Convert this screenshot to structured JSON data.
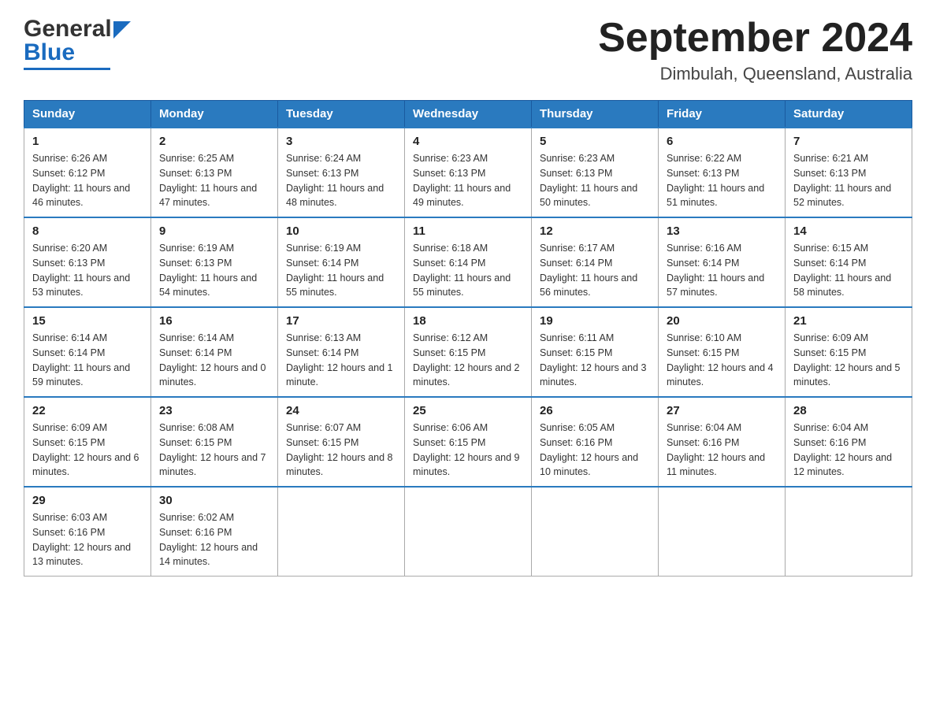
{
  "header": {
    "logo": {
      "general": "General",
      "blue": "Blue"
    },
    "title": "September 2024",
    "location": "Dimbulah, Queensland, Australia"
  },
  "weekdays": [
    "Sunday",
    "Monday",
    "Tuesday",
    "Wednesday",
    "Thursday",
    "Friday",
    "Saturday"
  ],
  "weeks": [
    [
      {
        "day": "1",
        "sunrise": "Sunrise: 6:26 AM",
        "sunset": "Sunset: 6:12 PM",
        "daylight": "Daylight: 11 hours and 46 minutes."
      },
      {
        "day": "2",
        "sunrise": "Sunrise: 6:25 AM",
        "sunset": "Sunset: 6:13 PM",
        "daylight": "Daylight: 11 hours and 47 minutes."
      },
      {
        "day": "3",
        "sunrise": "Sunrise: 6:24 AM",
        "sunset": "Sunset: 6:13 PM",
        "daylight": "Daylight: 11 hours and 48 minutes."
      },
      {
        "day": "4",
        "sunrise": "Sunrise: 6:23 AM",
        "sunset": "Sunset: 6:13 PM",
        "daylight": "Daylight: 11 hours and 49 minutes."
      },
      {
        "day": "5",
        "sunrise": "Sunrise: 6:23 AM",
        "sunset": "Sunset: 6:13 PM",
        "daylight": "Daylight: 11 hours and 50 minutes."
      },
      {
        "day": "6",
        "sunrise": "Sunrise: 6:22 AM",
        "sunset": "Sunset: 6:13 PM",
        "daylight": "Daylight: 11 hours and 51 minutes."
      },
      {
        "day": "7",
        "sunrise": "Sunrise: 6:21 AM",
        "sunset": "Sunset: 6:13 PM",
        "daylight": "Daylight: 11 hours and 52 minutes."
      }
    ],
    [
      {
        "day": "8",
        "sunrise": "Sunrise: 6:20 AM",
        "sunset": "Sunset: 6:13 PM",
        "daylight": "Daylight: 11 hours and 53 minutes."
      },
      {
        "day": "9",
        "sunrise": "Sunrise: 6:19 AM",
        "sunset": "Sunset: 6:13 PM",
        "daylight": "Daylight: 11 hours and 54 minutes."
      },
      {
        "day": "10",
        "sunrise": "Sunrise: 6:19 AM",
        "sunset": "Sunset: 6:14 PM",
        "daylight": "Daylight: 11 hours and 55 minutes."
      },
      {
        "day": "11",
        "sunrise": "Sunrise: 6:18 AM",
        "sunset": "Sunset: 6:14 PM",
        "daylight": "Daylight: 11 hours and 55 minutes."
      },
      {
        "day": "12",
        "sunrise": "Sunrise: 6:17 AM",
        "sunset": "Sunset: 6:14 PM",
        "daylight": "Daylight: 11 hours and 56 minutes."
      },
      {
        "day": "13",
        "sunrise": "Sunrise: 6:16 AM",
        "sunset": "Sunset: 6:14 PM",
        "daylight": "Daylight: 11 hours and 57 minutes."
      },
      {
        "day": "14",
        "sunrise": "Sunrise: 6:15 AM",
        "sunset": "Sunset: 6:14 PM",
        "daylight": "Daylight: 11 hours and 58 minutes."
      }
    ],
    [
      {
        "day": "15",
        "sunrise": "Sunrise: 6:14 AM",
        "sunset": "Sunset: 6:14 PM",
        "daylight": "Daylight: 11 hours and 59 minutes."
      },
      {
        "day": "16",
        "sunrise": "Sunrise: 6:14 AM",
        "sunset": "Sunset: 6:14 PM",
        "daylight": "Daylight: 12 hours and 0 minutes."
      },
      {
        "day": "17",
        "sunrise": "Sunrise: 6:13 AM",
        "sunset": "Sunset: 6:14 PM",
        "daylight": "Daylight: 12 hours and 1 minute."
      },
      {
        "day": "18",
        "sunrise": "Sunrise: 6:12 AM",
        "sunset": "Sunset: 6:15 PM",
        "daylight": "Daylight: 12 hours and 2 minutes."
      },
      {
        "day": "19",
        "sunrise": "Sunrise: 6:11 AM",
        "sunset": "Sunset: 6:15 PM",
        "daylight": "Daylight: 12 hours and 3 minutes."
      },
      {
        "day": "20",
        "sunrise": "Sunrise: 6:10 AM",
        "sunset": "Sunset: 6:15 PM",
        "daylight": "Daylight: 12 hours and 4 minutes."
      },
      {
        "day": "21",
        "sunrise": "Sunrise: 6:09 AM",
        "sunset": "Sunset: 6:15 PM",
        "daylight": "Daylight: 12 hours and 5 minutes."
      }
    ],
    [
      {
        "day": "22",
        "sunrise": "Sunrise: 6:09 AM",
        "sunset": "Sunset: 6:15 PM",
        "daylight": "Daylight: 12 hours and 6 minutes."
      },
      {
        "day": "23",
        "sunrise": "Sunrise: 6:08 AM",
        "sunset": "Sunset: 6:15 PM",
        "daylight": "Daylight: 12 hours and 7 minutes."
      },
      {
        "day": "24",
        "sunrise": "Sunrise: 6:07 AM",
        "sunset": "Sunset: 6:15 PM",
        "daylight": "Daylight: 12 hours and 8 minutes."
      },
      {
        "day": "25",
        "sunrise": "Sunrise: 6:06 AM",
        "sunset": "Sunset: 6:15 PM",
        "daylight": "Daylight: 12 hours and 9 minutes."
      },
      {
        "day": "26",
        "sunrise": "Sunrise: 6:05 AM",
        "sunset": "Sunset: 6:16 PM",
        "daylight": "Daylight: 12 hours and 10 minutes."
      },
      {
        "day": "27",
        "sunrise": "Sunrise: 6:04 AM",
        "sunset": "Sunset: 6:16 PM",
        "daylight": "Daylight: 12 hours and 11 minutes."
      },
      {
        "day": "28",
        "sunrise": "Sunrise: 6:04 AM",
        "sunset": "Sunset: 6:16 PM",
        "daylight": "Daylight: 12 hours and 12 minutes."
      }
    ],
    [
      {
        "day": "29",
        "sunrise": "Sunrise: 6:03 AM",
        "sunset": "Sunset: 6:16 PM",
        "daylight": "Daylight: 12 hours and 13 minutes."
      },
      {
        "day": "30",
        "sunrise": "Sunrise: 6:02 AM",
        "sunset": "Sunset: 6:16 PM",
        "daylight": "Daylight: 12 hours and 14 minutes."
      },
      null,
      null,
      null,
      null,
      null
    ]
  ]
}
